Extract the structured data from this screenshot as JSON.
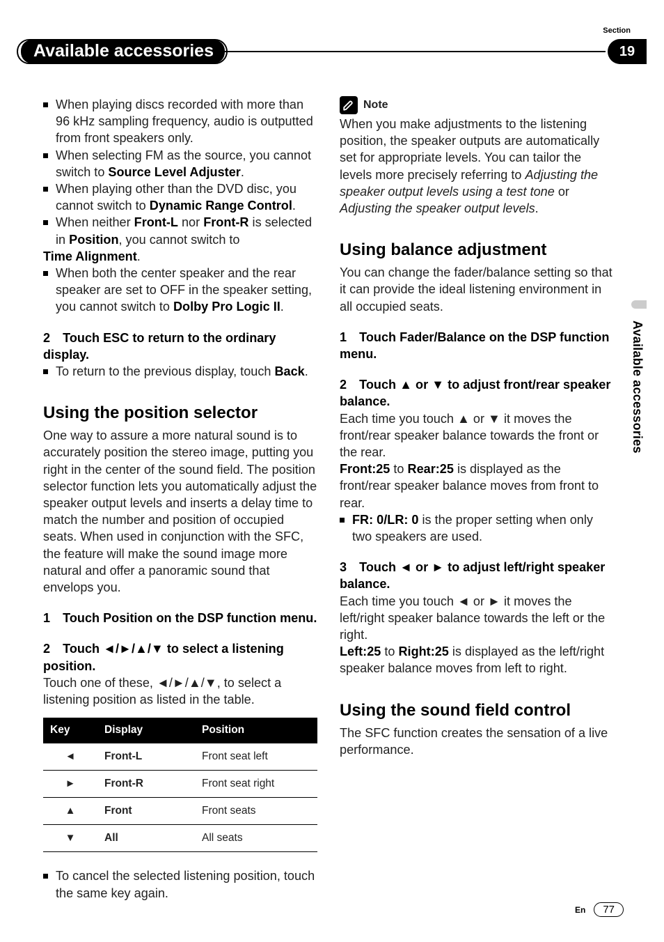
{
  "header": {
    "section_label": "Section",
    "section_number": "19",
    "title": "Available accessories",
    "side_text": "Available accessories"
  },
  "left": {
    "bullets_top": [
      {
        "pre": "When playing discs recorded with more than 96 kHz sampling frequency, audio is outputted from front speakers only.",
        "bolds": []
      },
      {
        "pre": "When selecting FM as the source, you cannot switch to ",
        "bolds": [
          "Source Level Adjuster"
        ],
        "post": "."
      },
      {
        "pre": "When playing other than the DVD disc, you cannot switch to ",
        "bolds": [
          "Dynamic Range Control"
        ],
        "post": "."
      },
      {
        "pre": "When neither ",
        "bolds": [
          "Front-L"
        ],
        "mid1": " nor ",
        "bolds2": [
          "Front-R"
        ],
        "mid2": " is selected in ",
        "bolds3": [
          "Position"
        ],
        "post": ", you cannot switch to"
      },
      {
        "trail_bold": "Time Alignment",
        "trail_post": "."
      },
      {
        "pre": "When both the center speaker and the rear speaker are set to OFF in the speaker setting, you cannot switch to ",
        "bolds": [
          "Dolby Pro Logic II"
        ],
        "post": "."
      }
    ],
    "step2_head": "2 Touch ESC to return to the ordinary display.",
    "step2_bullet_pre": "To return to the previous display, touch ",
    "step2_bullet_bold": "Back",
    "step2_bullet_post": ".",
    "h_pos": "Using the position selector",
    "pos_para": "One way to assure a more natural sound is to accurately position the stereo image, putting you right in the center of the sound field. The position selector function lets you automatically adjust the speaker output levels and inserts a delay time to match the number and position of occupied seats. When used in conjunction with the SFC, the feature will make the sound image more natural and offer a panoramic sound that envelops you.",
    "pos_step1": "1 Touch Position on the DSP function menu.",
    "pos_step2_head": "2 Touch ◄/►/▲/▼ to select a listening position.",
    "pos_step2_body_pre": "Touch one of these, ",
    "pos_step2_body_arrows": "◄/►/▲/▼",
    "pos_step2_body_post": ", to select a listening position as listed in the table.",
    "table": {
      "headers": [
        "Key",
        "Display",
        "Position"
      ],
      "rows": [
        {
          "key": "◄",
          "display": "Front-L",
          "position": "Front seat left"
        },
        {
          "key": "►",
          "display": "Front-R",
          "position": "Front seat right"
        },
        {
          "key": "▲",
          "display": "Front",
          "position": "Front seats"
        },
        {
          "key": "▼",
          "display": "All",
          "position": "All seats"
        }
      ]
    },
    "cancel_bullet": "To cancel the selected listening position, touch the same key again."
  },
  "right": {
    "note_label": "Note",
    "note_body_pre": "When you make adjustments to the listening position, the speaker outputs are automatically set for appropriate levels. You can tailor the levels more precisely referring to ",
    "note_ital1": "Adjusting the speaker output levels using a test tone",
    "note_mid": " or ",
    "note_ital2": "Adjusting the speaker output levels",
    "note_post": ".",
    "h_bal": "Using balance adjustment",
    "bal_para": "You can change the fader/balance setting so that it can provide the ideal listening environment in all occupied seats.",
    "bal_step1": "1 Touch Fader/Balance on the DSP function menu.",
    "bal_step2_head": "2 Touch ▲ or ▼ to adjust front/rear speaker balance.",
    "bal_step2_b1_pre": "Each time you touch ",
    "bal_step2_b1_a1": "▲",
    "bal_step2_b1_mid": " or ",
    "bal_step2_b1_a2": "▼",
    "bal_step2_b1_post": " it moves the front/rear speaker balance towards the front or the rear.",
    "bal_step2_line2_b1": "Front:25",
    "bal_step2_line2_mid": " to ",
    "bal_step2_line2_b2": "Rear:25",
    "bal_step2_line2_post": " is displayed as the front/rear speaker balance moves from front to rear.",
    "bal_step2_bullet_b": "FR: 0/LR: 0",
    "bal_step2_bullet_post": " is the proper setting when only two speakers are used.",
    "bal_step3_head": "3 Touch ◄ or ► to adjust left/right speaker balance.",
    "bal_step3_b1_pre": "Each time you touch ",
    "bal_step3_b1_a1": "◄",
    "bal_step3_b1_mid": " or ",
    "bal_step3_b1_a2": "►",
    "bal_step3_b1_post": " it moves the left/right speaker balance towards the left or the right.",
    "bal_step3_line2_b1": "Left:25",
    "bal_step3_line2_mid": " to ",
    "bal_step3_line2_b2": "Right:25",
    "bal_step3_line2_post": " is displayed as the left/right speaker balance moves from left to right.",
    "h_sfc": "Using the sound field control",
    "sfc_para": "The SFC function creates the sensation of a live performance."
  },
  "footer": {
    "lang": "En",
    "page": "77"
  }
}
